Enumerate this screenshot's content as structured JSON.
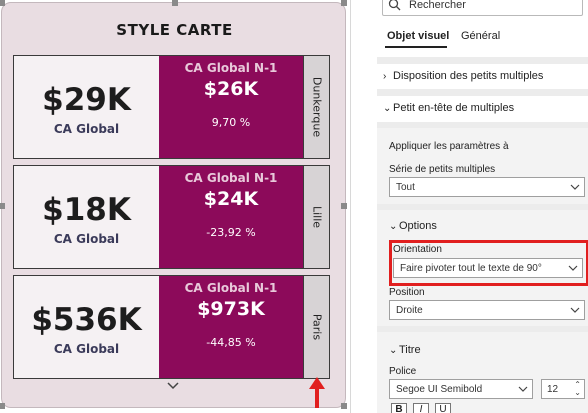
{
  "visual": {
    "title": "STYLE CARTE",
    "cards": [
      {
        "value": "$29K",
        "value_label": "CA Global",
        "prev_label": "CA Global N-1",
        "prev_value": "$26K",
        "pct": "9,70 %",
        "city": "Dunkerque"
      },
      {
        "value": "$18K",
        "value_label": "CA Global",
        "prev_label": "CA Global N-1",
        "prev_value": "$24K",
        "pct": "-23,92 %",
        "city": "Lille"
      },
      {
        "value": "$536K",
        "value_label": "CA Global",
        "prev_label": "CA Global N-1",
        "prev_value": "$973K",
        "pct": "-44,85 %",
        "city": "Paris"
      }
    ]
  },
  "panel": {
    "search_placeholder": "Rechercher",
    "tabs": [
      "Objet visuel",
      "Général"
    ],
    "active_tab": "Objet visuel",
    "sections": {
      "small_multiples_layout": "Disposition des petits multiples",
      "multiples_header": "Petit en-tête de multiples",
      "apply_settings_to": "Appliquer les paramètres à",
      "series_label": "Série de petits multiples",
      "series_value": "Tout",
      "options": "Options",
      "orientation_label": "Orientation",
      "orientation_value": "Faire pivoter tout le texte de 90°",
      "position_label": "Position",
      "position_value": "Droite",
      "title_section": "Titre",
      "font_label": "Police",
      "font_value": "Segoe UI Semibold",
      "font_size": "12",
      "bold": "B",
      "italic": "I",
      "underline": "U"
    },
    "colors": {
      "card_accent": "#8c0a5a",
      "highlight": "#e11f1f",
      "arrow": "#e11f1f"
    }
  }
}
